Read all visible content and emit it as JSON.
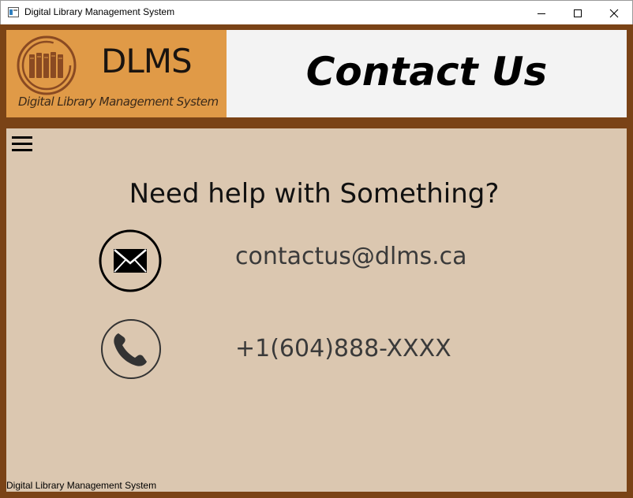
{
  "window": {
    "title": "Digital Library Management System"
  },
  "header": {
    "brand_name": "DLMS",
    "brand_subtitle": "Digital Library Management System",
    "page_title": "Contact Us"
  },
  "main": {
    "heading": "Need help with Something?",
    "email": "contactus@dlms.ca",
    "phone": "+1(604)888-XXXX"
  },
  "footer": {
    "text": "Digital Library Management System"
  },
  "icons": {
    "menu": "hamburger-menu-icon",
    "email": "envelope-icon",
    "phone": "phone-handset-icon",
    "logo": "library-books-logo"
  },
  "colors": {
    "frame": "#7a4316",
    "logo_panel": "#e09a47",
    "title_panel": "#f3f3f3",
    "content_bg": "#dbc7b0"
  }
}
